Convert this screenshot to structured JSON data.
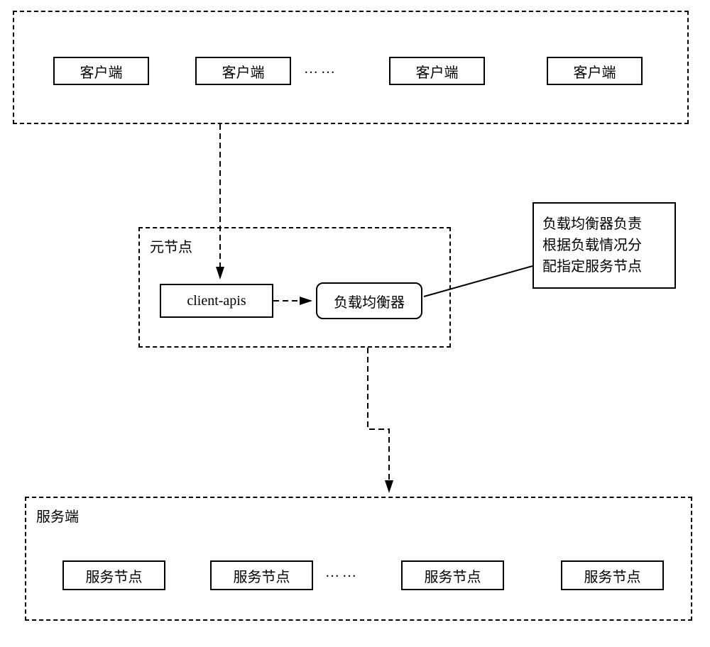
{
  "top_group": {
    "clients": [
      "客户端",
      "客户端",
      "客户端",
      "客户端"
    ],
    "ellipsis": "……"
  },
  "meta_node": {
    "label": "元节点",
    "client_apis": "client-apis",
    "load_balancer": "负载均衡器"
  },
  "note": {
    "line1": "负载均衡器负责",
    "line2": "根据负载情况分",
    "line3": "配指定服务节点"
  },
  "server_group": {
    "label": "服务端",
    "nodes": [
      "服务节点",
      "服务节点",
      "服务节点",
      "服务节点"
    ],
    "ellipsis": "……"
  }
}
